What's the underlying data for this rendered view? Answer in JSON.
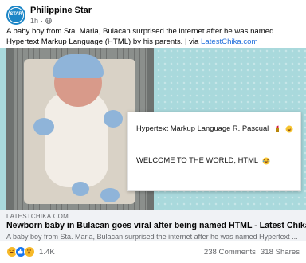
{
  "post": {
    "page_name": "Philippine Star",
    "avatar_text": "STAR",
    "time": "1h",
    "dot": "·",
    "caption_text": "A baby boy from Sta. Maria, Bulacan surprised the internet after he was named Hypertext Markup Language (HTML) by his parents. | via ",
    "caption_link": "LatestChika.com"
  },
  "image": {
    "card_line1": "Hypertext Markup Language R. Pascual",
    "card_line2": "WELCOME TO THE WORLD, HTML"
  },
  "link_preview": {
    "domain": "LATESTCHIKA.COM",
    "title": "Newborn baby in Bulacan goes viral after being named HTML - Latest Chika",
    "description": "A baby boy from Sta. Maria, Bulacan surprised the internet after he was named Hypertext ..."
  },
  "engagement": {
    "reaction_count": "1.4K",
    "comments": "238 Comments",
    "shares": "318 Shares"
  },
  "colors": {
    "brand": "#1d86c7",
    "link": "#216fdb",
    "muted": "#65676b",
    "preview_bg": "#f0f2f5",
    "photo_bg": "#a9d9dc"
  },
  "icons": [
    "globe-icon",
    "lipstick-icon",
    "grin-sweat-icon",
    "laugh-tears-icon",
    "haha-icon",
    "like-icon",
    "wow-icon"
  ]
}
